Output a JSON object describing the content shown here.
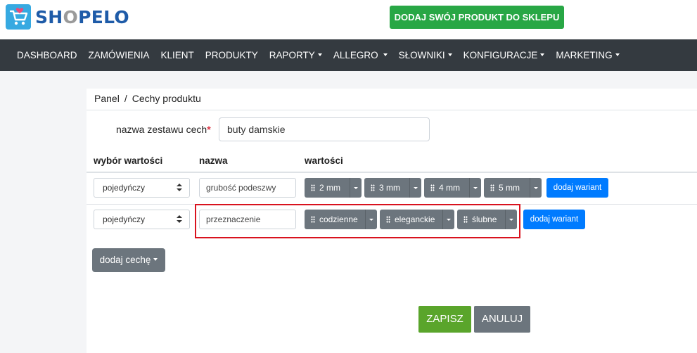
{
  "header": {
    "logo_text_1": "SH",
    "logo_text_o": "O",
    "logo_text_2": "PELO",
    "cta_label": "DODAJ SWÓJ PRODUKT DO SKLEPU",
    "cta_color": "#28a745"
  },
  "nav": {
    "items": [
      {
        "label": "DASHBOARD"
      },
      {
        "label": "ZAMÓWIENIA"
      },
      {
        "label": "KLIENT"
      },
      {
        "label": "PRODUKTY"
      },
      {
        "label": "RAPORTY"
      },
      {
        "label": "ALLEGRO"
      },
      {
        "label": "SŁOWNIKI"
      },
      {
        "label": "KONFIGURACJE"
      },
      {
        "label": "MARKETING"
      }
    ]
  },
  "breadcrumb": {
    "root": "Panel",
    "separator": "/",
    "current": "Cechy produktu"
  },
  "form": {
    "set_name_label": "nazwa zestawu cech",
    "required_mark": "*",
    "set_name_value": "buty damskie"
  },
  "table": {
    "headers": [
      "wybór wartości",
      "nazwa",
      "wartości"
    ],
    "rows": [
      {
        "mode": "pojedyńczy",
        "name": "grubość podeszwy",
        "values": [
          "2 mm",
          "3 mm",
          "4 mm",
          "5 mm"
        ],
        "add_variant": "dodaj wariant"
      },
      {
        "mode": "pojedyńczy",
        "name": "przeznaczenie",
        "values": [
          "codzienne",
          "eleganckie",
          "ślubne"
        ],
        "add_variant": "dodaj wariant"
      }
    ]
  },
  "actions": {
    "add_feature": "dodaj cechę",
    "save": "ZAPISZ",
    "cancel": "ANULUJ"
  },
  "colors": {
    "navbar": "#343a40",
    "primary": "#007bff",
    "secondary": "#6c757d",
    "highlight": "#d9121e"
  }
}
